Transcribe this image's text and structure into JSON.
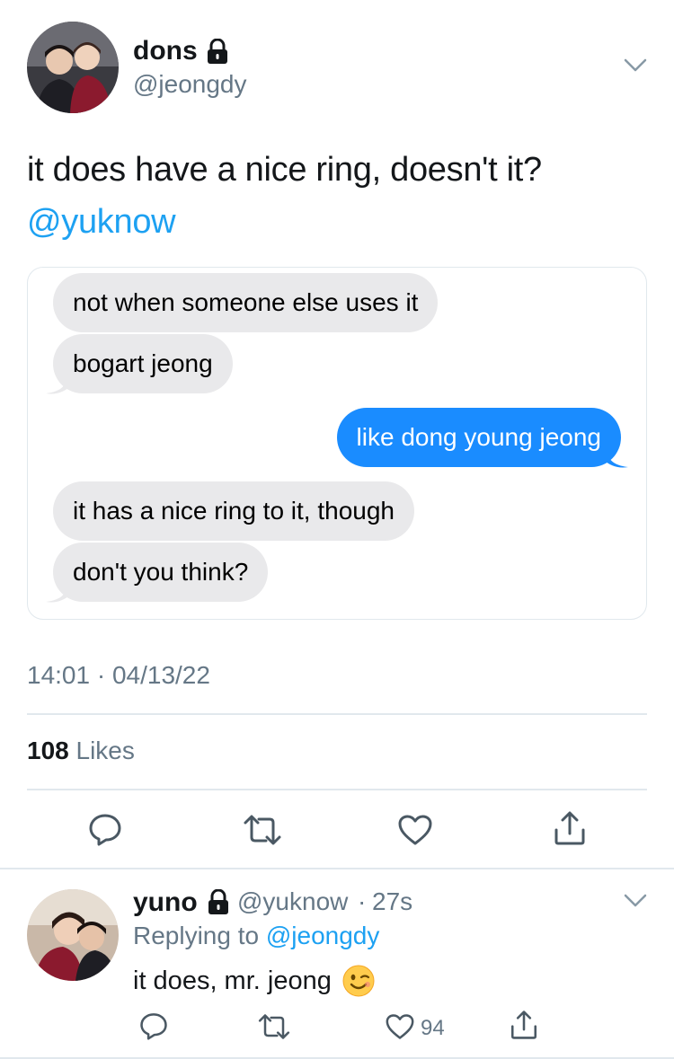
{
  "tweet": {
    "display_name": "dons",
    "handle": "@jeongdy",
    "text": "it does have a nice ring, doesn't it?",
    "mention": "@yuknow",
    "timestamp": "14:01 · 04/13/22",
    "likes_count": "108",
    "likes_label": "Likes"
  },
  "chat_image": {
    "messages": [
      {
        "side": "received",
        "text": "not when someone else uses it"
      },
      {
        "side": "received",
        "text": "bogart jeong"
      },
      {
        "side": "sent",
        "text": "like dong young jeong"
      },
      {
        "side": "received",
        "text": "it has a nice ring to it, though"
      },
      {
        "side": "received",
        "text": "don't you think?"
      }
    ]
  },
  "reply": {
    "display_name": "yuno",
    "handle": "@yuknow",
    "separator": "·",
    "age": "27s",
    "replying_prefix": "Replying to",
    "replying_to": "@jeongdy",
    "text": "it does, mr. jeong",
    "emoji": "winking-face",
    "like_count": "94"
  },
  "colors": {
    "accent": "#1da1f2",
    "secondary_text": "#657786",
    "sent_bubble": "#1a8cff",
    "received_bubble": "#e9e9eb"
  },
  "icons": [
    "lock-icon",
    "chevron-down-icon",
    "reply-icon",
    "retweet-icon",
    "like-icon",
    "share-icon",
    "winking-face-emoji"
  ]
}
